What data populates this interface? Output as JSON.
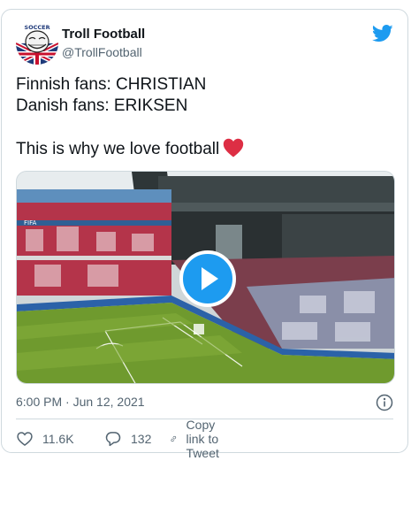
{
  "colors": {
    "brand": "#1d9bf0",
    "heart": "#f91880",
    "text_primary": "#0f1419",
    "text_secondary": "#536471",
    "border": "#cfd9de"
  },
  "author": {
    "name": "Troll Football",
    "handle": "@TrollFootball",
    "avatar_text": "SOCCER"
  },
  "tweet": {
    "line1": "Finnish fans: CHRISTIAN",
    "line2": "Danish fans: ERIKSEN",
    "line3": "This is why we love football",
    "emoji": "red-heart-emoji"
  },
  "media": {
    "type": "video",
    "play_icon": "play-icon",
    "board_label": "FIFA"
  },
  "meta": {
    "time": "6:00 PM",
    "separator": "·",
    "date": "Jun 12, 2021"
  },
  "actions": {
    "likes": "11.6K",
    "replies": "132",
    "copy_link": "Copy link to Tweet"
  },
  "icons": {
    "brand": "twitter-bird-icon",
    "info": "info-icon",
    "like": "heart-outline-icon",
    "reply": "reply-bubble-icon",
    "link": "link-icon"
  }
}
